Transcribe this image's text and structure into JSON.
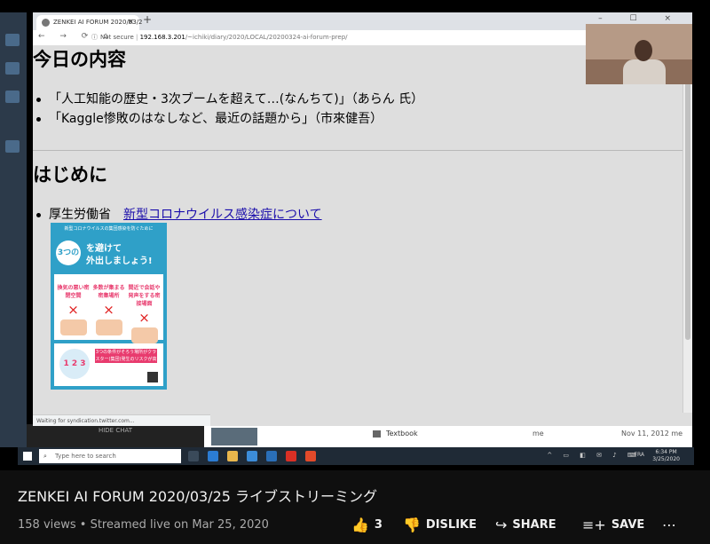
{
  "browser": {
    "tab_title": "ZENKEI AI FORUM 2020/03/2",
    "tab_close": "×",
    "new_tab": "+",
    "window_controls": "– ☐ ×",
    "nav_icons": "← → ⟳ ⌂",
    "security": "Not secure",
    "url_host": "192.168.3.201",
    "url_path": "/~ichiki/diary/2020/LOCAL/20200324-ai-forum-prep/",
    "status_text": "Waiting for syndication.twitter.com..."
  },
  "page": {
    "section1_title": "今日の内容",
    "agenda": [
      "「人工知能の歴史・3次ブームを超えて…(なんちて)」（あらん 氏）",
      "「Kaggle惨敗のはなしなど、最近の話題から」（市來健吾）"
    ],
    "section2_title": "はじめに",
    "intro_item": "厚生労働省",
    "intro_link": "新型コロナウイルス感染症について",
    "poster": {
      "top_text": "新型コロナウイルスの集団感染を防ぐために",
      "badge": "3つの",
      "line1": "を避けて",
      "line2": "外出しましょう!",
      "cells": [
        "換気の悪い密閉空間",
        "多数が集まる密集場所",
        "間近で会話や発声をする密接場面"
      ],
      "cross": "×",
      "numbers": "1 2 3",
      "message": "3つの条件がそろう場所がクラスター(集団)発生のリスクが高い!"
    }
  },
  "desktop": {
    "hide_chat": "HIDE CHAT",
    "file_name": "Textbook",
    "file_owner": "me",
    "file_date": "Nov 11, 2012  me",
    "search_placeholder": "Type here to search",
    "search_icon": "⌕",
    "tray": "^ ▭ ◧ ✉ ♪ ⌨",
    "lang": "FRA",
    "time": "6:34 PM",
    "date": "3/25/2020"
  },
  "video": {
    "title": "ZENKEI AI FORUM 2020/03/25 ライブストリーミング",
    "meta": "158 views • Streamed live on Mar 25, 2020",
    "like_count": "3",
    "dislike_label": "DISLIKE",
    "share_label": "SHARE",
    "save_label": "SAVE",
    "more": "⋯",
    "icons": {
      "like": "👍",
      "dislike": "👎",
      "share": "↪",
      "save": "≡+"
    }
  },
  "colors": {
    "link": "#1a0dab",
    "poster_blue": "#2fa0c8",
    "poster_pink": "#e83b6e",
    "page_bg": "#0f0f0f"
  }
}
